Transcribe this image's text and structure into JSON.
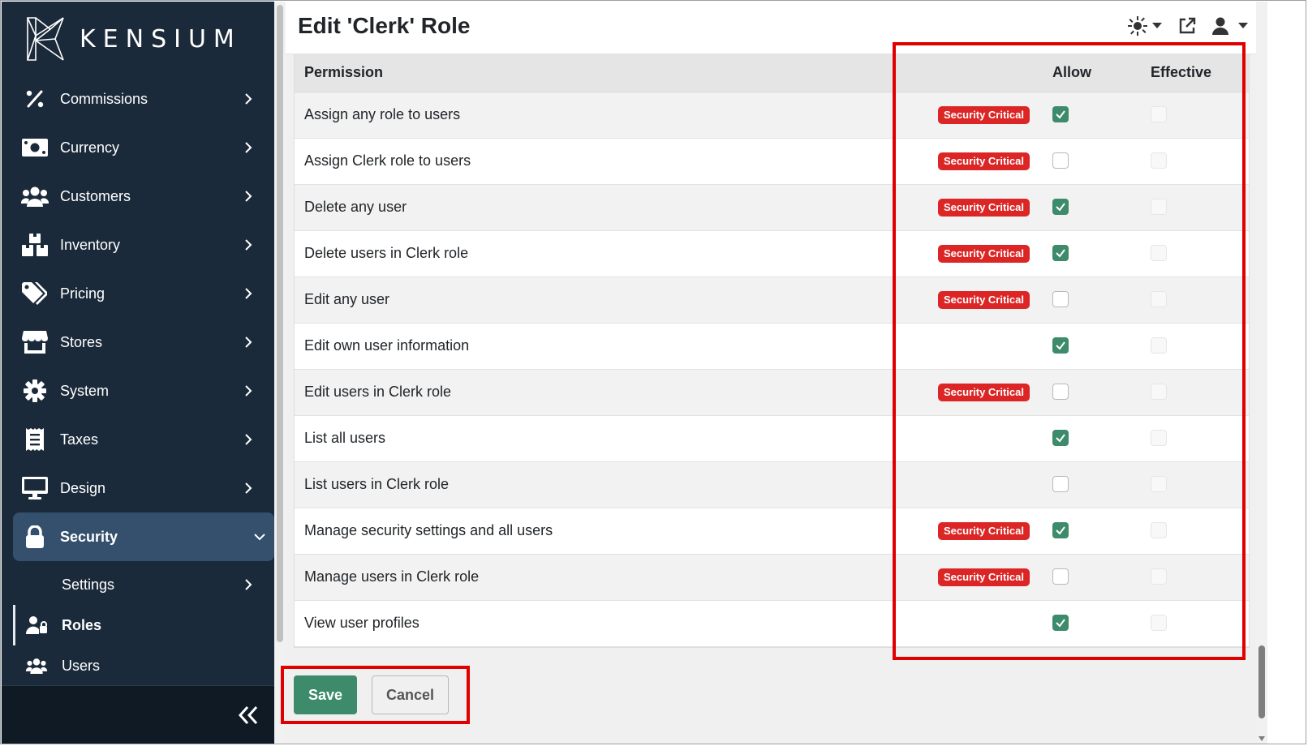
{
  "app": {
    "logo_text": "KENSIUM"
  },
  "sidebar": {
    "items": [
      {
        "label": "Commissions",
        "icon": "percent-icon"
      },
      {
        "label": "Currency",
        "icon": "money-icon"
      },
      {
        "label": "Customers",
        "icon": "users-icon"
      },
      {
        "label": "Inventory",
        "icon": "boxes-icon"
      },
      {
        "label": "Pricing",
        "icon": "tags-icon"
      },
      {
        "label": "Stores",
        "icon": "store-icon"
      },
      {
        "label": "System",
        "icon": "gear-icon"
      },
      {
        "label": "Taxes",
        "icon": "receipt-icon"
      },
      {
        "label": "Design",
        "icon": "monitor-icon"
      },
      {
        "label": "Security",
        "icon": "lock-icon"
      }
    ],
    "security_subitems": [
      {
        "label": "Settings"
      },
      {
        "label": "Roles",
        "icon": "user-lock-icon"
      },
      {
        "label": "Users",
        "icon": "users-icon"
      }
    ]
  },
  "header": {
    "title": "Edit 'Clerk' Role"
  },
  "table": {
    "columns": {
      "permission": "Permission",
      "allow": "Allow",
      "effective": "Effective"
    },
    "badge_text": "Security Critical",
    "rows": [
      {
        "permission": "Assign any role to users",
        "critical": true,
        "allow": true,
        "effective": false
      },
      {
        "permission": "Assign Clerk role to users",
        "critical": true,
        "allow": false,
        "effective": false
      },
      {
        "permission": "Delete any user",
        "critical": true,
        "allow": true,
        "effective": false
      },
      {
        "permission": "Delete users in Clerk role",
        "critical": true,
        "allow": true,
        "effective": false
      },
      {
        "permission": "Edit any user",
        "critical": true,
        "allow": false,
        "effective": false
      },
      {
        "permission": "Edit own user information",
        "critical": false,
        "allow": true,
        "effective": false
      },
      {
        "permission": "Edit users in Clerk role",
        "critical": true,
        "allow": false,
        "effective": false
      },
      {
        "permission": "List all users",
        "critical": false,
        "allow": true,
        "effective": false
      },
      {
        "permission": "List users in Clerk role",
        "critical": false,
        "allow": false,
        "effective": false
      },
      {
        "permission": "Manage security settings and all users",
        "critical": true,
        "allow": true,
        "effective": false
      },
      {
        "permission": "Manage users in Clerk role",
        "critical": true,
        "allow": false,
        "effective": false
      },
      {
        "permission": "View user profiles",
        "critical": false,
        "allow": true,
        "effective": false
      }
    ]
  },
  "actions": {
    "save_label": "Save",
    "cancel_label": "Cancel"
  },
  "colors": {
    "accent": "#3d8b6b",
    "critical": "#dc2626",
    "sidebar_bg": "#1b2a3a",
    "highlight": "#e00000"
  }
}
